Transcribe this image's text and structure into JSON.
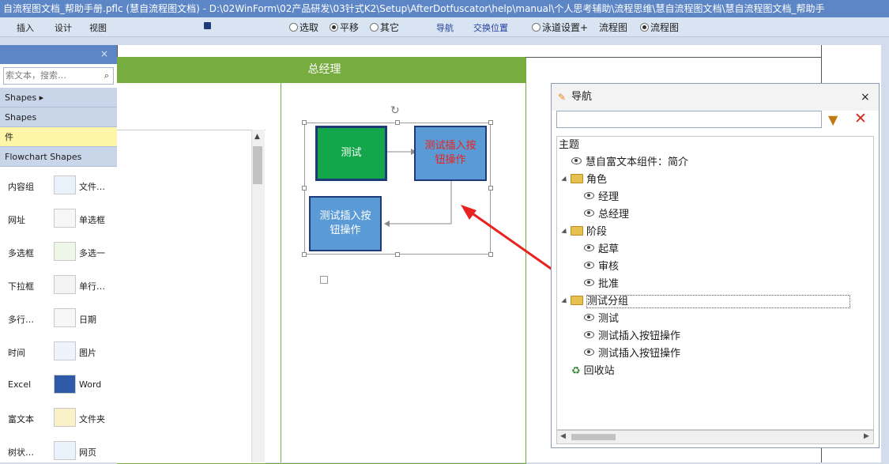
{
  "window": {
    "title": "自流程图文档_帮助手册.pflc (慧自流程图文档) - D:\\02WinForm\\02产品研发\\03针式K2\\Setup\\AfterDotfuscator\\help\\manual\\个人思考辅助\\流程思维\\慧自流程图文档\\慧自流程图文档_帮助手"
  },
  "menu": {
    "items": [
      "插入",
      "设计",
      "视图"
    ]
  },
  "toolbar": {
    "save_icon": "save-icon",
    "mode_options": [
      "选取",
      "平移",
      "其它"
    ],
    "mode_selected": "平移",
    "nav_link": "导航",
    "swap_link": "交换位置",
    "lane_settings": "泳道设置+",
    "view_option": "流程图",
    "view_selected": "流程图"
  },
  "toolbox": {
    "search_placeholder": "索文本，搜索…",
    "categories": [
      {
        "label": "Shapes ▸"
      },
      {
        "label": "Shapes"
      },
      {
        "label": "件"
      },
      {
        "label": "Flowchart Shapes"
      }
    ],
    "items": [
      {
        "left": "内容组",
        "right": "文件…"
      },
      {
        "left": "网址",
        "right": "单选框"
      },
      {
        "left": "多选框",
        "right": "多选一"
      },
      {
        "left": "下拉框",
        "right": "单行…"
      },
      {
        "left": "多行…",
        "right": "日期"
      },
      {
        "left": "时间",
        "right": "图片"
      },
      {
        "left": "Excel",
        "right": "Word"
      },
      {
        "left": "富文本",
        "right": "文件夹"
      },
      {
        "left": "树状…",
        "right": "网页"
      }
    ]
  },
  "canvas": {
    "lane_title": "总经理",
    "nodes": {
      "test": "测试",
      "insert_button_red": "测试插入按钮操作",
      "insert_button_blue": "测试插入按钮操作"
    }
  },
  "navigator": {
    "title": "导航",
    "close": "×",
    "tree": [
      {
        "label": "主题",
        "type": "header"
      },
      {
        "label": "慧自富文本组件：简介",
        "type": "item",
        "level": 1
      },
      {
        "label": "角色",
        "type": "folder",
        "level": 0
      },
      {
        "label": "经理",
        "type": "item",
        "level": 2
      },
      {
        "label": "总经理",
        "type": "item",
        "level": 2
      },
      {
        "label": "阶段",
        "type": "folder",
        "level": 0
      },
      {
        "label": "起草",
        "type": "item",
        "level": 2
      },
      {
        "label": "审核",
        "type": "item",
        "level": 2
      },
      {
        "label": "批准",
        "type": "item",
        "level": 2
      },
      {
        "label": "测试分组",
        "type": "folder",
        "level": 0
      },
      {
        "label": "测试",
        "type": "item",
        "level": 2
      },
      {
        "label": "测试插入按钮操作",
        "type": "item",
        "level": 2
      },
      {
        "label": "测试插入按钮操作",
        "type": "item",
        "level": 2
      },
      {
        "label": "回收站",
        "type": "recycle",
        "level": 1
      }
    ]
  },
  "colors": {
    "lane_green": "#77ad3f",
    "node_green": "#13a64a",
    "node_blue": "#5b9bd5",
    "annotation_red": "#e8231f"
  }
}
